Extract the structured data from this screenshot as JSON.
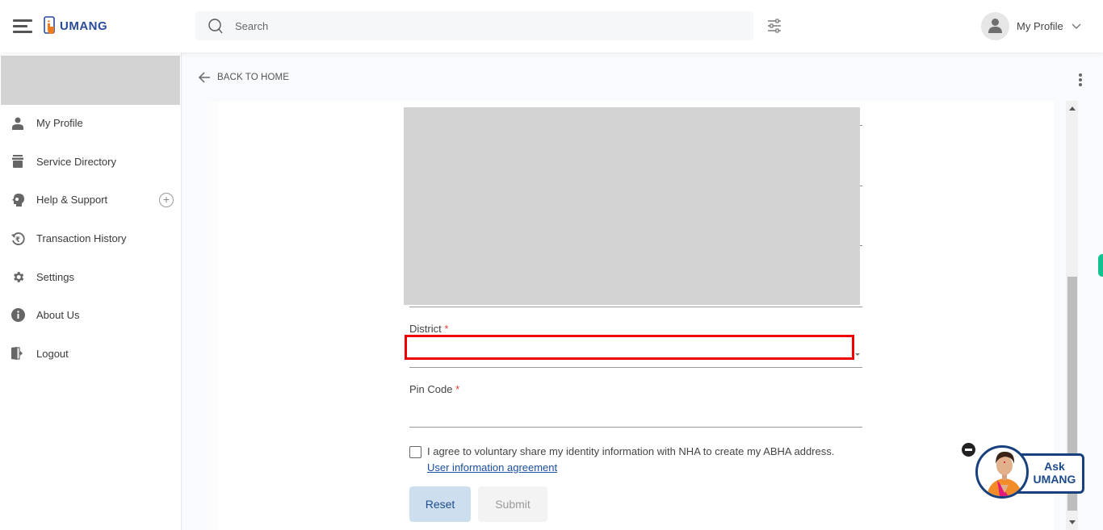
{
  "header": {
    "app_name": "UMANG",
    "search_placeholder": "Search",
    "profile_label": "My Profile"
  },
  "sidebar": {
    "items": [
      {
        "label": "My Profile",
        "icon": "user-icon"
      },
      {
        "label": "Service Directory",
        "icon": "archive-icon"
      },
      {
        "label": "Help & Support",
        "icon": "support-icon",
        "expandable": true
      },
      {
        "label": "Transaction History",
        "icon": "rupee-history-icon"
      },
      {
        "label": "Settings",
        "icon": "gear-icon"
      },
      {
        "label": "About Us",
        "icon": "info-icon"
      },
      {
        "label": "Logout",
        "icon": "logout-icon"
      }
    ]
  },
  "main": {
    "back_label": "BACK TO HOME",
    "form": {
      "district": {
        "label": "District",
        "required_mark": "*",
        "value": ""
      },
      "pincode": {
        "label": "Pin Code",
        "required_mark": "*",
        "value": ""
      },
      "consent": {
        "text": "I agree to voluntary share my identity information with NHA to create my ABHA address.",
        "link": "User information agreement",
        "checked": false
      },
      "reset_label": "Reset",
      "submit_label": "Submit"
    }
  },
  "assistant": {
    "line1": "Ask",
    "line2": "UMANG"
  },
  "colors": {
    "brand_blue": "#2a4a9c",
    "brand_orange": "#f07a1a",
    "highlight_red": "#ee0000",
    "required_red": "#e53935",
    "accent_green": "#12c391"
  }
}
